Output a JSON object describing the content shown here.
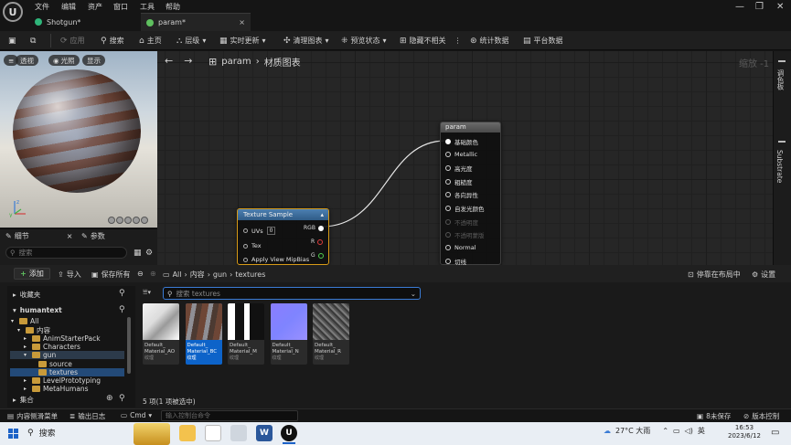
{
  "menubar": {
    "items": [
      "文件",
      "编辑",
      "资产",
      "窗口",
      "工具",
      "帮助"
    ],
    "logo_glyph": "U",
    "window_controls": [
      "—",
      "❐",
      "✕"
    ]
  },
  "tabs": [
    {
      "label": "Shotgun*",
      "dot_color": "#2fb57a"
    },
    {
      "label": "param*",
      "dot_color": "#5fc05f"
    }
  ],
  "tab_close": "×",
  "toolbar": {
    "apply": "应用",
    "search": "搜索",
    "home": "主页",
    "hierarchy": "层级",
    "live_update": "实时更新",
    "clean_graph": "清理图表",
    "preview_state": "预览状态",
    "hide_unrelated": "隐藏不相关",
    "stats": "统计数据",
    "platform_stats": "平台数据"
  },
  "viewport": {
    "buttons": [
      "透视",
      "光照",
      "显示"
    ]
  },
  "details_panel": {
    "tab_details": "细节",
    "tab_params": "参数",
    "search_placeholder": "搜索"
  },
  "graph": {
    "breadcrumb": [
      "param",
      "材质图表"
    ],
    "zoom": "缩放 -1",
    "right_tabs": [
      "调色板",
      "Substrate"
    ],
    "param_node": {
      "title": "param",
      "pins": [
        {
          "label": "基础颜色",
          "enabled": true,
          "connected": true
        },
        {
          "label": "Metallic",
          "enabled": true,
          "connected": false
        },
        {
          "label": "高光度",
          "enabled": true,
          "connected": false
        },
        {
          "label": "粗糙度",
          "enabled": true,
          "connected": false
        },
        {
          "label": "各向异性",
          "enabled": true,
          "connected": false
        },
        {
          "label": "自发光颜色",
          "enabled": true,
          "connected": false
        },
        {
          "label": "不透明度",
          "enabled": false,
          "connected": false
        },
        {
          "label": "不透明蒙版",
          "enabled": false,
          "connected": false
        },
        {
          "label": "Normal",
          "enabled": true,
          "connected": false
        },
        {
          "label": "切线",
          "enabled": true,
          "connected": false
        }
      ]
    },
    "texture_node": {
      "title": "Texture Sample",
      "inputs": [
        "UVs",
        "Tex",
        "Apply View MipBias"
      ],
      "uvs_value": "0",
      "outputs": [
        {
          "label": "RGB",
          "color": "#ffffff"
        },
        {
          "label": "R",
          "color": "#e03b3b"
        },
        {
          "label": "G",
          "color": "#4fd04f"
        }
      ]
    }
  },
  "content_browser": {
    "add": "添加",
    "import": "导入",
    "save_all": "保存所有",
    "path": [
      "All",
      "内容",
      "gun",
      "textures"
    ],
    "dock": "停靠在布局中",
    "settings": "设置",
    "favorites": "收藏夹",
    "project": "humantext",
    "tree": [
      {
        "label": "All",
        "depth": 0
      },
      {
        "label": "内容",
        "depth": 1
      },
      {
        "label": "AnimStarterPack",
        "depth": 2
      },
      {
        "label": "Characters",
        "depth": 2
      },
      {
        "label": "gun",
        "depth": 2
      },
      {
        "label": "source",
        "depth": 3
      },
      {
        "label": "textures",
        "depth": 3
      },
      {
        "label": "LevelPrototyping",
        "depth": 2
      },
      {
        "label": "MetaHumans",
        "depth": 2
      }
    ],
    "collections": "集合",
    "search_placeholder": "搜索 textures",
    "assets": [
      {
        "name": "Default_Material_AO",
        "name_shown": "Default_\nMaterial_AO",
        "type": "纹理",
        "selected": false
      },
      {
        "name": "Default_Material_BC",
        "name_shown": "Default_\nMaterial_BC",
        "type": "纹理",
        "selected": true
      },
      {
        "name": "Default_Material_M",
        "name_shown": "Default_\nMaterial_M",
        "type": "纹理",
        "selected": false
      },
      {
        "name": "Default_Material_N",
        "name_shown": "Default_\nMaterial_N",
        "type": "纹理",
        "selected": false
      },
      {
        "name": "Default_Material_R",
        "name_shown": "Default_\nMaterial_R",
        "type": "纹理",
        "selected": false
      }
    ],
    "status": "5 项(1 项被选中)"
  },
  "statusbar": {
    "content_drawer": "内容侧滑菜单",
    "output_log": "输出日志",
    "cmd": "Cmd",
    "console_placeholder": "输入控制台命令",
    "unsaved": "8未保存",
    "source_control": "版本控制"
  },
  "taskbar": {
    "search": "搜索",
    "weather": "27°C 大雨",
    "ime": "英",
    "time": "16:53",
    "date": "2023/6/12"
  }
}
